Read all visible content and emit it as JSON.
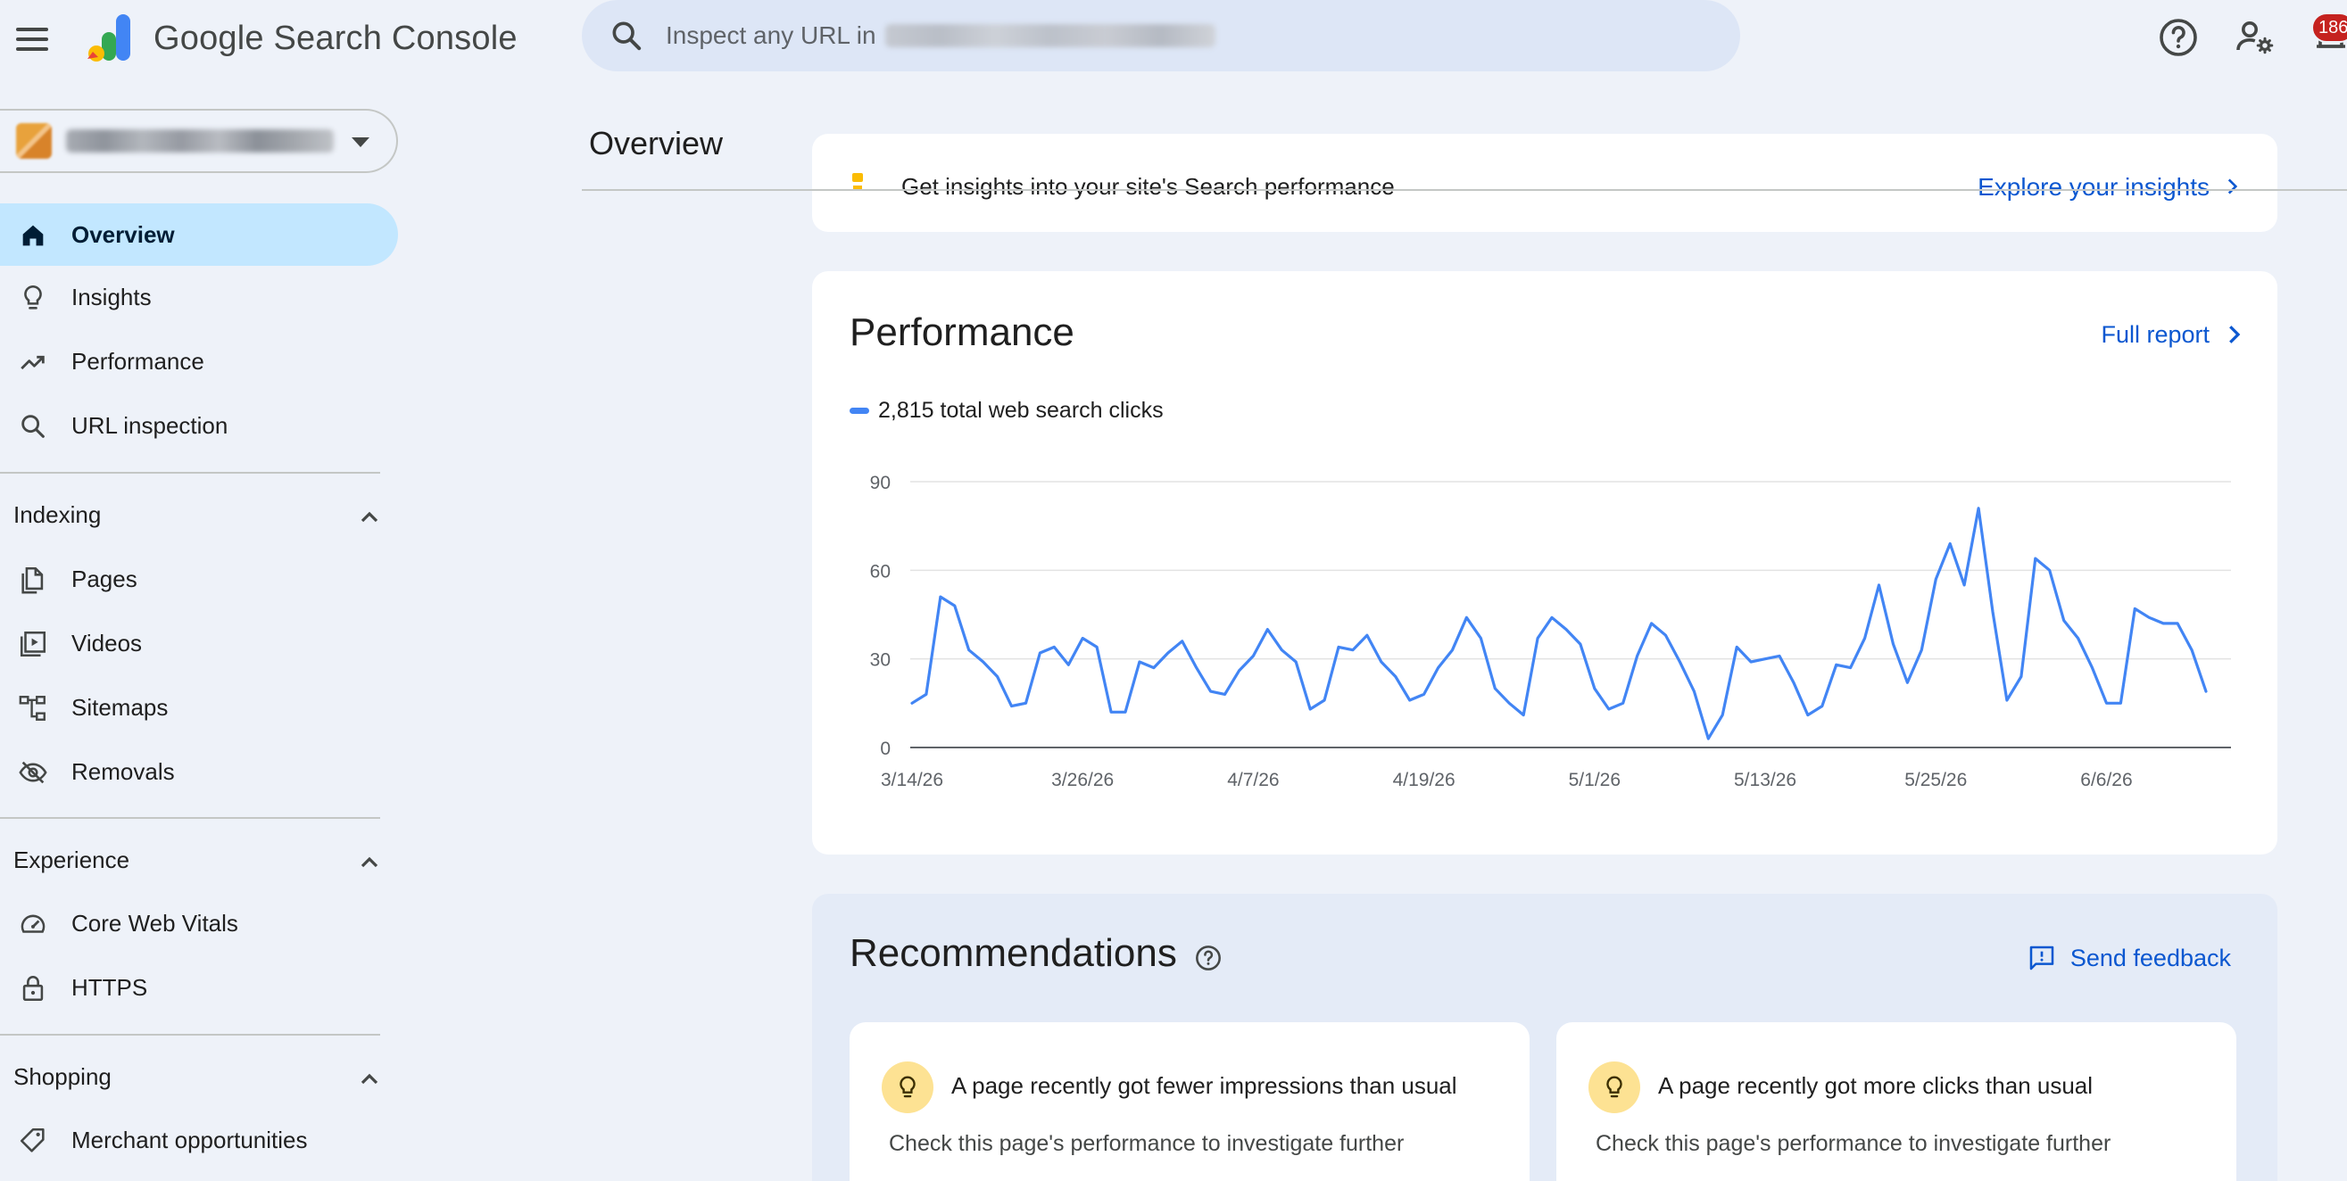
{
  "app": {
    "title": "Google Search Console",
    "search_placeholder": "Inspect any URL in",
    "notification_count": "186"
  },
  "sidebar": {
    "items": [
      {
        "label": "Overview",
        "icon": "home-icon",
        "active": true
      },
      {
        "label": "Insights",
        "icon": "lightbulb-icon"
      },
      {
        "label": "Performance",
        "icon": "trending-up-icon"
      },
      {
        "label": "URL inspection",
        "icon": "search-icon"
      }
    ],
    "sections": [
      {
        "label": "Indexing",
        "items": [
          {
            "label": "Pages",
            "icon": "pages-icon"
          },
          {
            "label": "Videos",
            "icon": "video-icon"
          },
          {
            "label": "Sitemaps",
            "icon": "sitemap-icon"
          },
          {
            "label": "Removals",
            "icon": "eye-off-icon"
          }
        ]
      },
      {
        "label": "Experience",
        "items": [
          {
            "label": "Core Web Vitals",
            "icon": "speedometer-icon"
          },
          {
            "label": "HTTPS",
            "icon": "lock-icon"
          }
        ]
      },
      {
        "label": "Shopping",
        "items": [
          {
            "label": "Merchant opportunities",
            "icon": "tag-icon"
          }
        ]
      }
    ]
  },
  "main": {
    "page_title": "Overview",
    "insights_banner": {
      "text": "Get insights into your site's Search performance",
      "link": "Explore your insights"
    },
    "performance": {
      "title": "Performance",
      "full_report": "Full report",
      "legend": "2,815 total web search clicks"
    },
    "recommendations": {
      "title": "Recommendations",
      "feedback": "Send feedback",
      "cards": [
        {
          "title": "A page recently got fewer impressions than usual",
          "description": "Check this page's performance to investigate further"
        },
        {
          "title": "A page recently got more clicks than usual",
          "description": "Check this page's performance to investigate further"
        }
      ]
    }
  },
  "colors": {
    "accent": "#0b57d0",
    "line": "#4285f4",
    "active_nav": "#c2e7ff",
    "background": "#eef2f9"
  },
  "chart_data": {
    "type": "line",
    "title": "",
    "xlabel": "",
    "ylabel": "",
    "ylim": [
      0,
      90
    ],
    "yticks": [
      0,
      30,
      60,
      90
    ],
    "xtick_labels": [
      "3/14/26",
      "3/26/26",
      "4/7/26",
      "4/19/26",
      "5/1/26",
      "5/13/26",
      "5/25/26",
      "6/6/26"
    ],
    "grid": true,
    "legend_position": "top-left",
    "series": [
      {
        "name": "total web search clicks",
        "color": "#4285f4",
        "start_date": "2026-03-14",
        "values": [
          15,
          18,
          51,
          48,
          33,
          29,
          24,
          14,
          15,
          32,
          34,
          28,
          37,
          34,
          12,
          12,
          29,
          27,
          32,
          36,
          27,
          19,
          18,
          26,
          31,
          40,
          33,
          29,
          13,
          16,
          34,
          33,
          38,
          29,
          24,
          16,
          18,
          27,
          33,
          44,
          37,
          20,
          15,
          11,
          37,
          44,
          40,
          35,
          20,
          13,
          15,
          31,
          42,
          38,
          29,
          19,
          3,
          11,
          34,
          29,
          30,
          31,
          22,
          11,
          14,
          28,
          27,
          37,
          55,
          35,
          22,
          33,
          57,
          69,
          55,
          81,
          46,
          16,
          24,
          64,
          60,
          43,
          37,
          27,
          15,
          15,
          47,
          44,
          42,
          42,
          33,
          19
        ]
      }
    ]
  }
}
